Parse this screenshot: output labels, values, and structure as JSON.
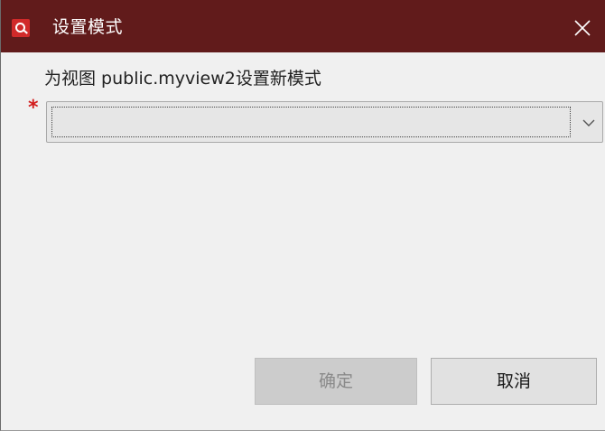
{
  "window": {
    "title": "设置模式",
    "close_glyph": "✕",
    "app_icon": "app-logo-icon",
    "titlebar_color": "#611b1b"
  },
  "form": {
    "prompt": "为视图 public.myview2设置新模式",
    "required_mark": "*",
    "schema_select": {
      "value": "",
      "icon": "chevron-down-icon"
    }
  },
  "buttons": {
    "ok_label": "确定",
    "ok_enabled": false,
    "cancel_label": "取消"
  }
}
